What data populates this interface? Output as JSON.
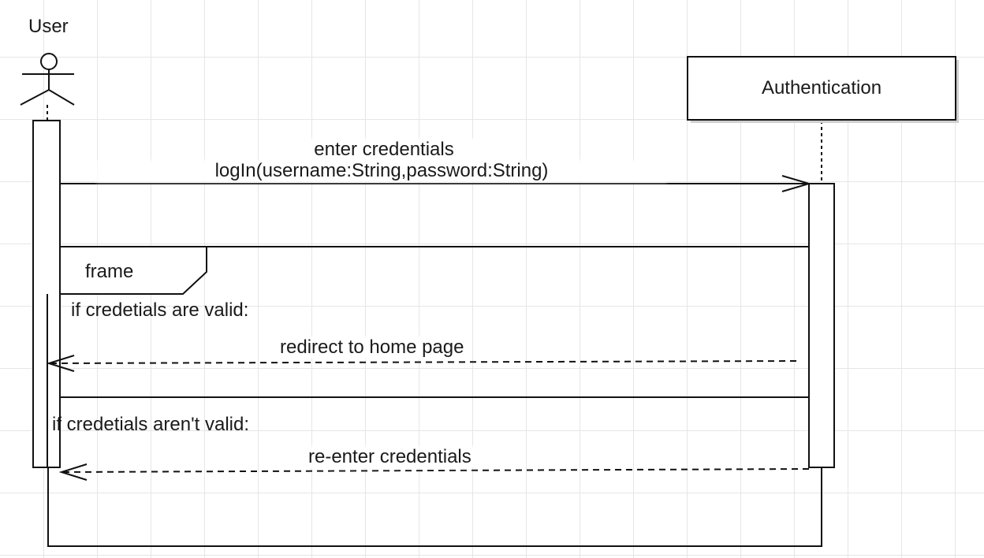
{
  "diagram": {
    "type": "uml-sequence",
    "lifelines": [
      {
        "id": "user",
        "label": "User",
        "kind": "actor"
      },
      {
        "id": "auth",
        "label": "Authentication",
        "kind": "object"
      }
    ],
    "messages": [
      {
        "id": "m1",
        "from": "user",
        "to": "auth",
        "style": "solid",
        "label_top": "enter credentials",
        "label": "logIn(username:String,password:String)"
      },
      {
        "id": "m2",
        "from": "auth",
        "to": "user",
        "style": "dashed",
        "label": "redirect to home page"
      },
      {
        "id": "m3",
        "from": "auth",
        "to": "user",
        "style": "dashed",
        "label": "re-enter credentials"
      }
    ],
    "fragment": {
      "label": "frame",
      "guards": [
        "if credetials are valid:",
        "if credetials aren't valid:"
      ]
    },
    "colors": {
      "line": "#111111",
      "grid": "#e6e6e6",
      "background": "#ffffff"
    }
  }
}
